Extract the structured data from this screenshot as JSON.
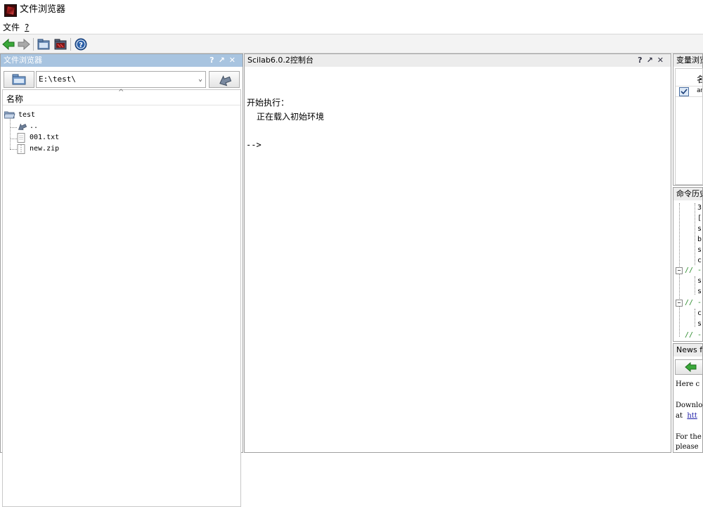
{
  "window": {
    "title": "文件浏览器"
  },
  "menu": {
    "items": [
      "文件",
      "?"
    ]
  },
  "toolbar": {
    "buttons": [
      "back-icon",
      "forward-icon",
      "file-browser-icon",
      "console-icon",
      "help-icon"
    ]
  },
  "file_browser": {
    "title": "文件浏览器",
    "path": "E:\\test\\",
    "column_header": "名称",
    "tree": {
      "root": "test",
      "items": [
        "..",
        "001.txt",
        "new.zip"
      ]
    }
  },
  "console": {
    "title": "Scilab6.0.2控制台",
    "lines": [
      "开始执行：",
      "正在载入初始环境"
    ],
    "prompt": "-->"
  },
  "variable_browser": {
    "title": "变量浏览",
    "column_header": "名",
    "row_text": "an"
  },
  "command_history": {
    "title": "命令历史",
    "entries": [
      "3",
      "[",
      "s",
      "b",
      "s",
      "c",
      "// -",
      "s",
      "s",
      "// -",
      "c",
      "s",
      "// -"
    ]
  },
  "news_feed": {
    "title": "News f",
    "lines": [
      "Here c",
      "",
      "Downlo",
      "at htt",
      "",
      "For the",
      "please"
    ],
    "link": "htt"
  },
  "colors": {
    "active_header": "#a8c4e0",
    "accent_green": "#3aa83a",
    "link": "#1a1aa8"
  }
}
